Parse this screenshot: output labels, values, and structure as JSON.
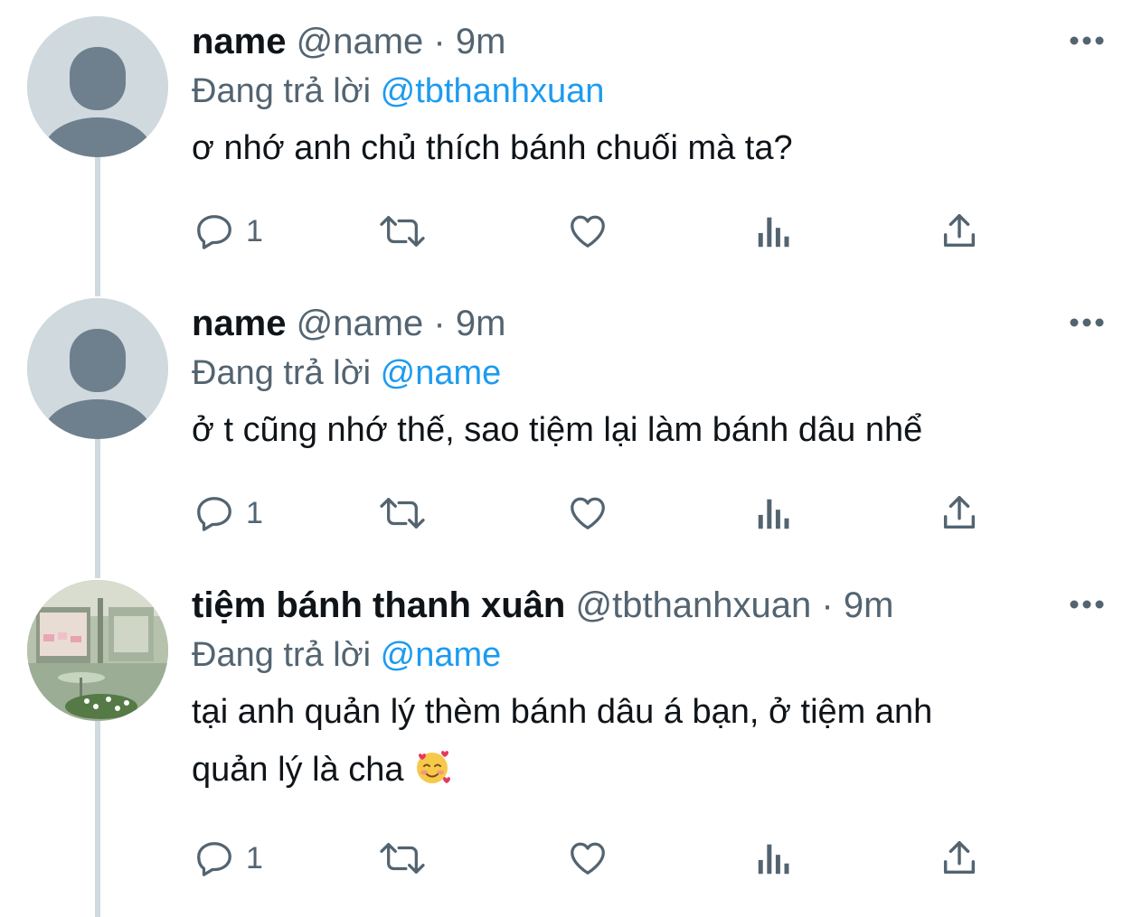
{
  "tweets": [
    {
      "display_name": "name",
      "handle": "@name",
      "dot": "·",
      "time": "9m",
      "reply_prefix": "Đang trả lời",
      "reply_to": "@tbthanhxuan",
      "text": "ơ nhớ anh chủ thích bánh chuối mà ta?",
      "reply_count": "1",
      "avatar": "default-avatar-icon"
    },
    {
      "display_name": "name",
      "handle": "@name",
      "dot": "·",
      "time": "9m",
      "reply_prefix": "Đang trả lời",
      "reply_to": "@name",
      "text": "ở t cũng nhớ thế, sao tiệm lại làm bánh dâu nhể",
      "reply_count": "1",
      "avatar": "default-avatar-icon"
    },
    {
      "display_name": "tiệm bánh thanh xuân",
      "handle": "@tbthanhxuan",
      "dot": "·",
      "time": "9m",
      "reply_prefix": "Đang trả lời",
      "reply_to": "@name",
      "text_line1": "tại anh quản lý thèm bánh dâu á bạn, ở tiệm anh",
      "text_line2": "quản lý là cha",
      "reply_count": "1",
      "avatar": "shop-photo-avatar",
      "emoji": "smiling-face-with-hearts-emoji"
    }
  ],
  "colors": {
    "text": "#0f1419",
    "secondary": "#536471",
    "link": "#1d9bf0",
    "thread_line": "#cfd9de",
    "avatar_bg": "#cfd9de",
    "avatar_fg": "#6e7f8d"
  },
  "icons": {
    "more": "more-icon",
    "reply": "reply-icon",
    "retweet": "retweet-icon",
    "like": "heart-icon",
    "views": "views-icon",
    "share": "share-icon"
  }
}
